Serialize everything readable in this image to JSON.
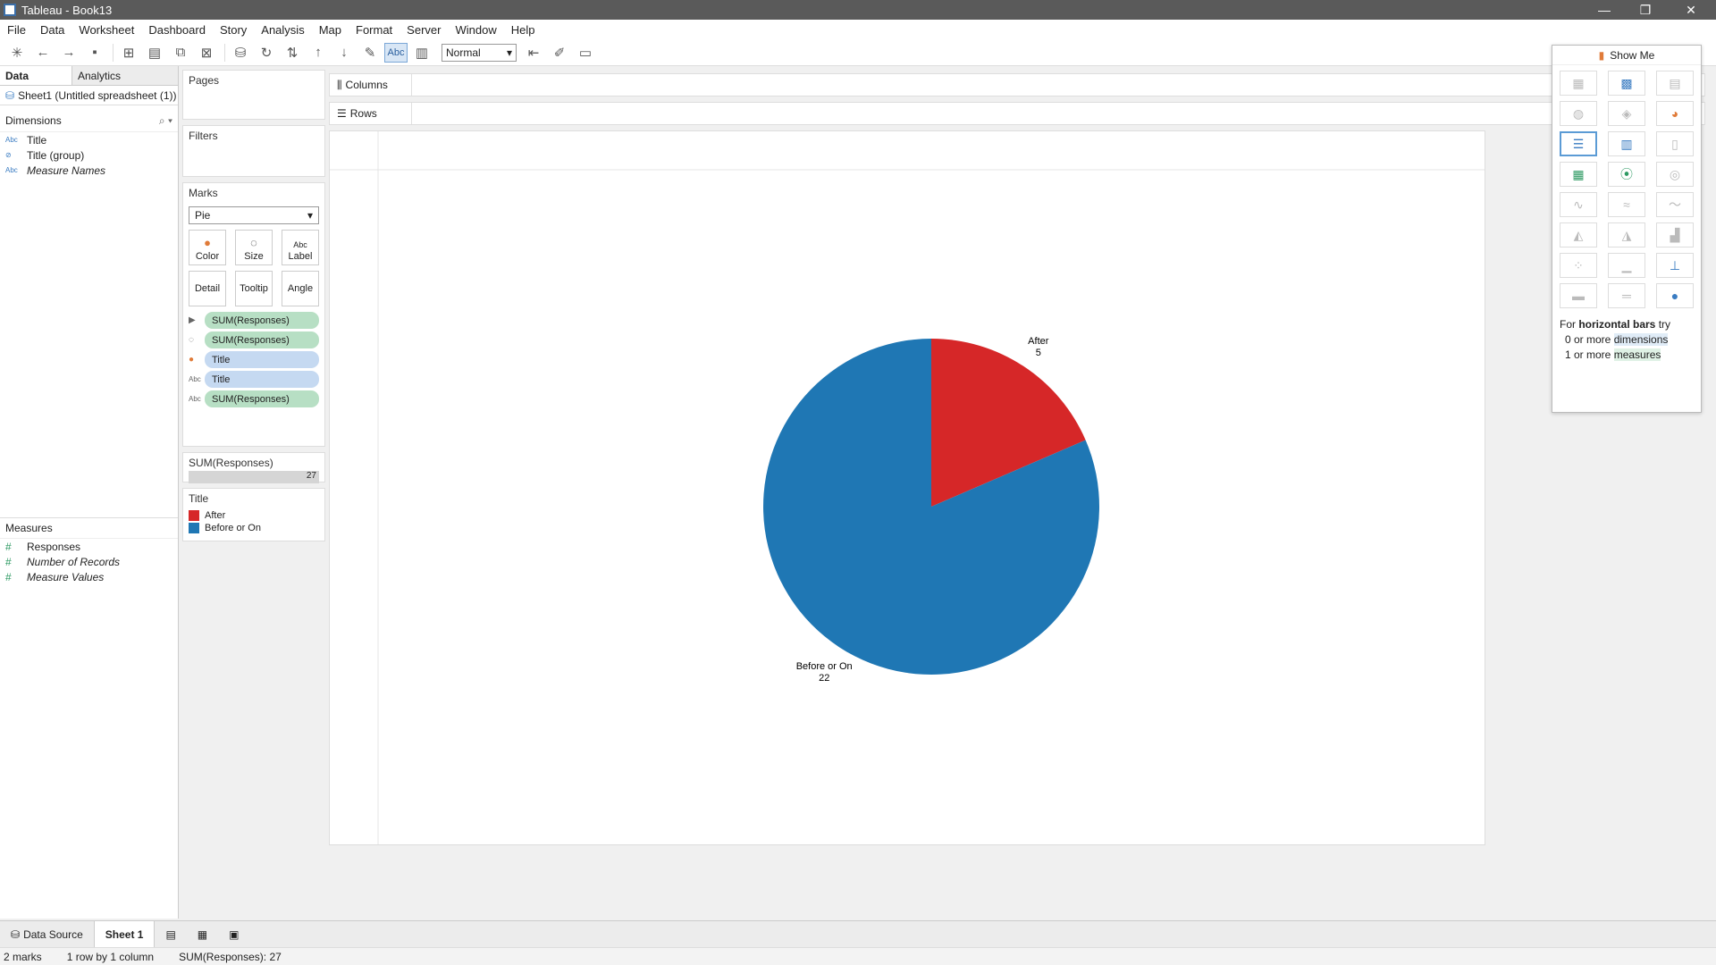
{
  "window": {
    "title": "Tableau - Book13",
    "min": "—",
    "max": "❐",
    "close": "✕"
  },
  "menu": [
    "File",
    "Data",
    "Worksheet",
    "Dashboard",
    "Story",
    "Analysis",
    "Map",
    "Format",
    "Server",
    "Window",
    "Help"
  ],
  "toolbar": {
    "fit_select": "Normal",
    "abc": "Abc"
  },
  "data_pane": {
    "tab_data": "Data",
    "tab_analytics": "Analytics",
    "datasource": "Sheet1 (Untitled spreadsheet (1))",
    "dimensions_header": "Dimensions",
    "dimensions": [
      {
        "type": "Abc",
        "label": "Title"
      },
      {
        "type": "⊘",
        "label": "Title (group)"
      },
      {
        "type": "Abc",
        "label": "Measure Names"
      }
    ],
    "measures_header": "Measures",
    "measures": [
      {
        "type": "#",
        "label": "Responses"
      },
      {
        "type": "#",
        "label": "Number of Records"
      },
      {
        "type": "#",
        "label": "Measure Values"
      }
    ]
  },
  "cards": {
    "pages": "Pages",
    "filters": "Filters",
    "marks": "Marks",
    "mark_type": "Pie",
    "buttons": {
      "color": "Color",
      "size": "Size",
      "label": "Label",
      "detail": "Detail",
      "tooltip": "Tooltip",
      "angle": "Angle"
    },
    "pills": [
      "SUM(Responses)",
      "SUM(Responses)",
      "Title",
      "Title",
      "SUM(Responses)"
    ],
    "size_legend_title": "SUM(Responses)",
    "size_legend_value": "27",
    "color_legend_title": "Title",
    "color_legend": [
      {
        "label": "After",
        "color": "#d62728"
      },
      {
        "label": "Before or On",
        "color": "#1f77b4"
      }
    ]
  },
  "shelves": {
    "columns": "Columns",
    "rows": "Rows"
  },
  "chart_data": {
    "type": "pie",
    "categories": [
      "After",
      "Before or On"
    ],
    "values": [
      5,
      22
    ],
    "colors": [
      "#d62728",
      "#1f77b4"
    ]
  },
  "show_me": {
    "title": "Show Me",
    "hint_prefix": "For",
    "hint_chart": "horizontal bars",
    "hint_suffix": "try",
    "hint_dims_prefix": "0 or more",
    "hint_dims": "dimensions",
    "hint_meas_prefix": "1 or more",
    "hint_meas": "measures"
  },
  "bottom_tabs": {
    "data_source": "Data Source",
    "sheet1": "Sheet 1"
  },
  "status": {
    "marks": "2 marks",
    "rows": "1 row by 1 column",
    "sum": "SUM(Responses): 27"
  }
}
